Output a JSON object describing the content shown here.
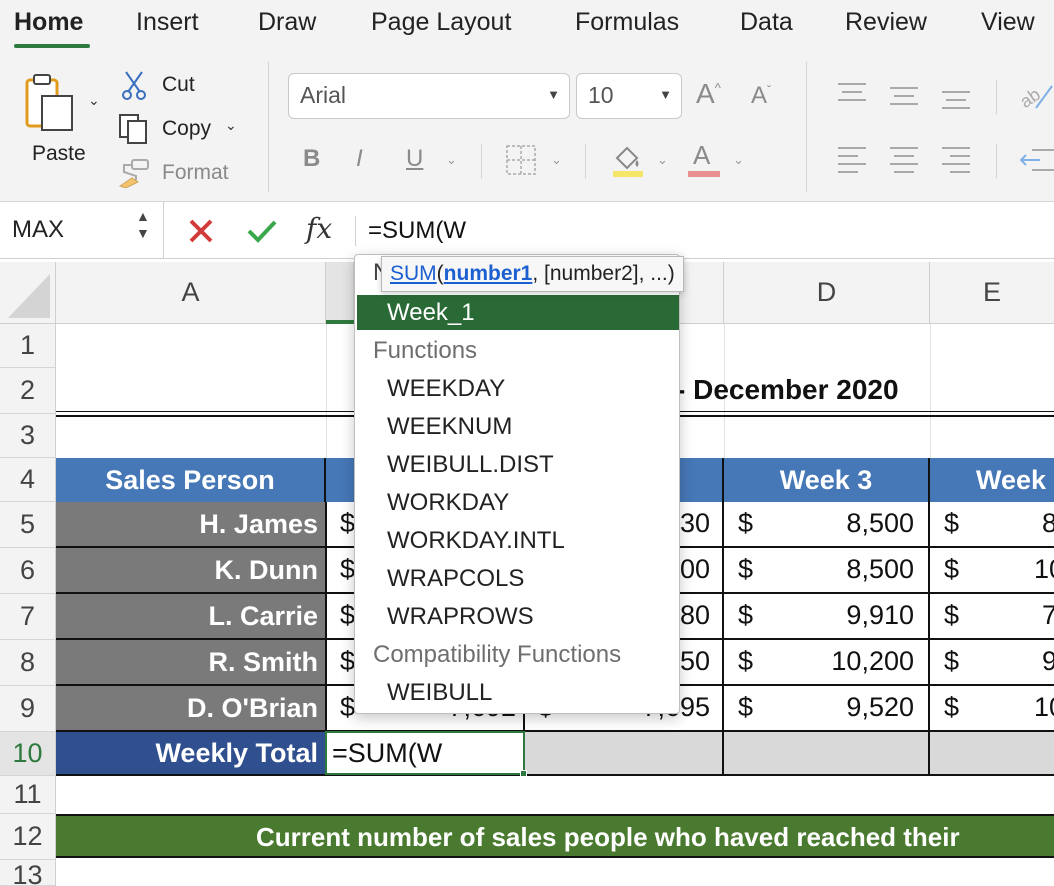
{
  "tabs": [
    "Home",
    "Insert",
    "Draw",
    "Page Layout",
    "Formulas",
    "Data",
    "Review",
    "View"
  ],
  "clipboard": {
    "paste": "Paste",
    "cut": "Cut",
    "copy": "Copy",
    "format": "Format"
  },
  "font": {
    "name": "Arial",
    "size": "10",
    "bold": "B",
    "italic": "I",
    "underline": "U",
    "font_color_glyph": "A"
  },
  "colors": {
    "accent": "#2e7a3e",
    "header_blue": "#4677b6",
    "name_gray": "#7a7a7a",
    "total_blue": "#2f4f8f",
    "banner_green": "#4a7a30",
    "highlight_yellow": "#f5e66a",
    "font_red": "#e89090"
  },
  "formula_bar": {
    "name_box": "MAX",
    "fx": "fx",
    "formula": "=SUM(W"
  },
  "columns": [
    "A",
    "D",
    "E"
  ],
  "rows": [
    "1",
    "2",
    "3",
    "4",
    "5",
    "6",
    "7",
    "8",
    "9",
    "10",
    "11",
    "12",
    "13"
  ],
  "sheet": {
    "title_partial": "- December 2020",
    "header_sales_person": "Sales Person",
    "header_week3": "Week 3",
    "header_week4_partial": "Week",
    "currency": "$",
    "people": [
      {
        "name": "H. James",
        "week2_partial": "30",
        "week3": "8,500",
        "week4_partial": "8"
      },
      {
        "name": "K. Dunn",
        "week2_partial": "00",
        "week3": "8,500",
        "week4_partial": "10"
      },
      {
        "name": "L. Carrie",
        "week2_partial": "80",
        "week3": "9,910",
        "week4_partial": "7"
      },
      {
        "name": "R. Smith",
        "week2_partial": "50",
        "week3": "10,200",
        "week4_partial": "9"
      },
      {
        "name": "D. O'Brian",
        "week1_partial": "7,692",
        "week2_partial": "7,695",
        "week3": "9,520",
        "week4_partial": "10"
      }
    ],
    "weekly_total": "Weekly Total",
    "editing_value": "=SUM(W",
    "banner": "Current number of sales people who haved reached their"
  },
  "autocomplete": {
    "tooltip": {
      "fn": "SUM",
      "open": "(",
      "arg1": "number1",
      "rest": ", [number2], ...)"
    },
    "header_partial": "N",
    "selected": "Week_1",
    "group_functions": "Functions",
    "functions": [
      "WEEKDAY",
      "WEEKNUM",
      "WEIBULL.DIST",
      "WORKDAY",
      "WORKDAY.INTL",
      "WRAPCOLS",
      "WRAPROWS"
    ],
    "group_compat": "Compatibility Functions",
    "compat": [
      "WEIBULL"
    ]
  }
}
